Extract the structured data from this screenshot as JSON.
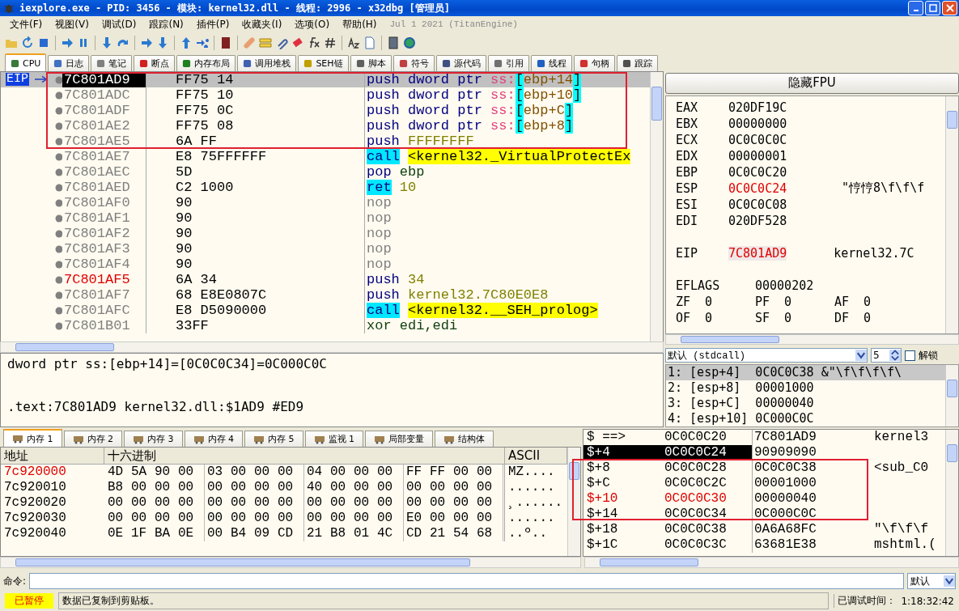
{
  "window": {
    "title": "iexplore.exe - PID: 3456 - 模块: kernel32.dll - 线程: 2996 - x32dbg [管理员]"
  },
  "menu": [
    "文件(F)",
    "视图(V)",
    "调试(D)",
    "跟踪(N)",
    "插件(P)",
    "收藏夹(I)",
    "选项(O)",
    "帮助(H)"
  ],
  "build_info": "Jul 1 2021 (TitanEngine)",
  "tabs": [
    {
      "label": "CPU",
      "selected": true
    },
    {
      "label": "日志",
      "selected": false
    },
    {
      "label": "笔记",
      "selected": false
    },
    {
      "label": "断点",
      "selected": false
    },
    {
      "label": "内存布局",
      "selected": false
    },
    {
      "label": "调用堆栈",
      "selected": false
    },
    {
      "label": "SEH链",
      "selected": false
    },
    {
      "label": "脚本",
      "selected": false
    },
    {
      "label": "符号",
      "selected": false
    },
    {
      "label": "源代码",
      "selected": false
    },
    {
      "label": "引用",
      "selected": false
    },
    {
      "label": "线程",
      "selected": false
    },
    {
      "label": "句柄",
      "selected": false
    },
    {
      "label": "跟踪",
      "selected": false
    }
  ],
  "disasm": {
    "eip_label": "EIP",
    "rows": [
      {
        "addr": "7C801AD9",
        "bytes": "FF75 14",
        "selected": true,
        "addr_highlight": false,
        "tokens": [
          {
            "text": "push",
            "kind": "op"
          },
          {
            "text": "dword",
            "kind": "size"
          },
          {
            "text": "ptr",
            "kind": "size"
          },
          {
            "text": "ss:",
            "kind": "seg"
          },
          {
            "text": "[",
            "kind": "br"
          },
          {
            "text": "ebp+14",
            "kind": "mem"
          },
          {
            "text": "]",
            "kind": "br"
          }
        ]
      },
      {
        "addr": "7C801ADC",
        "bytes": "FF75 10",
        "selected": false,
        "addr_highlight": false,
        "tokens": [
          {
            "text": "push",
            "kind": "op"
          },
          {
            "text": "dword",
            "kind": "size"
          },
          {
            "text": "ptr",
            "kind": "size"
          },
          {
            "text": "ss:",
            "kind": "seg"
          },
          {
            "text": "[",
            "kind": "br"
          },
          {
            "text": "ebp+10",
            "kind": "mem"
          },
          {
            "text": "]",
            "kind": "br"
          }
        ]
      },
      {
        "addr": "7C801ADF",
        "bytes": "FF75 0C",
        "selected": false,
        "addr_highlight": false,
        "tokens": [
          {
            "text": "push",
            "kind": "op"
          },
          {
            "text": "dword",
            "kind": "size"
          },
          {
            "text": "ptr",
            "kind": "size"
          },
          {
            "text": "ss:",
            "kind": "seg"
          },
          {
            "text": "[",
            "kind": "br"
          },
          {
            "text": "ebp+C",
            "kind": "mem"
          },
          {
            "text": "]",
            "kind": "br"
          }
        ]
      },
      {
        "addr": "7C801AE2",
        "bytes": "FF75 08",
        "selected": false,
        "addr_highlight": false,
        "tokens": [
          {
            "text": "push",
            "kind": "op"
          },
          {
            "text": "dword",
            "kind": "size"
          },
          {
            "text": "ptr",
            "kind": "size"
          },
          {
            "text": "ss:",
            "kind": "seg"
          },
          {
            "text": "[",
            "kind": "br"
          },
          {
            "text": "ebp+8",
            "kind": "mem"
          },
          {
            "text": "]",
            "kind": "br"
          }
        ]
      },
      {
        "addr": "7C801AE5",
        "bytes": "6A FF",
        "selected": false,
        "addr_highlight": false,
        "tokens": [
          {
            "text": "push",
            "kind": "op"
          },
          {
            "text": "FFFFFFFF",
            "kind": "num"
          }
        ]
      },
      {
        "addr": "7C801AE7",
        "bytes": "E8 75FFFFFF",
        "selected": false,
        "addr_highlight": false,
        "tokens": [
          {
            "text": "call",
            "kind": "callop"
          },
          {
            "text": "<kernel32._VirtualProtectEx",
            "kind": "label"
          }
        ]
      },
      {
        "addr": "7C801AEC",
        "bytes": "5D",
        "selected": false,
        "addr_highlight": false,
        "tokens": [
          {
            "text": "pop",
            "kind": "op"
          },
          {
            "text": "ebp",
            "kind": "reg"
          }
        ]
      },
      {
        "addr": "7C801AED",
        "bytes": "C2 1000",
        "selected": false,
        "addr_highlight": false,
        "tokens": [
          {
            "text": "ret",
            "kind": "callop"
          },
          {
            "text": "10",
            "kind": "num"
          }
        ]
      },
      {
        "addr": "7C801AF0",
        "bytes": "90",
        "selected": false,
        "addr_highlight": false,
        "tokens": [
          {
            "text": "nop",
            "kind": "nop"
          }
        ]
      },
      {
        "addr": "7C801AF1",
        "bytes": "90",
        "selected": false,
        "addr_highlight": false,
        "tokens": [
          {
            "text": "nop",
            "kind": "nop"
          }
        ]
      },
      {
        "addr": "7C801AF2",
        "bytes": "90",
        "selected": false,
        "addr_highlight": false,
        "tokens": [
          {
            "text": "nop",
            "kind": "nop"
          }
        ]
      },
      {
        "addr": "7C801AF3",
        "bytes": "90",
        "selected": false,
        "addr_highlight": false,
        "tokens": [
          {
            "text": "nop",
            "kind": "nop"
          }
        ]
      },
      {
        "addr": "7C801AF4",
        "bytes": "90",
        "selected": false,
        "addr_highlight": false,
        "tokens": [
          {
            "text": "nop",
            "kind": "nop"
          }
        ]
      },
      {
        "addr": "7C801AF5",
        "bytes": "6A 34",
        "selected": false,
        "addr_highlight": true,
        "tokens": [
          {
            "text": "push",
            "kind": "op"
          },
          {
            "text": "34",
            "kind": "num"
          }
        ]
      },
      {
        "addr": "7C801AF7",
        "bytes": "68 E8E0807C",
        "selected": false,
        "addr_highlight": false,
        "tokens": [
          {
            "text": "push",
            "kind": "op"
          },
          {
            "text": "kernel32.7C80E0E8",
            "kind": "num"
          }
        ]
      },
      {
        "addr": "7C801AFC",
        "bytes": "E8 D5090000",
        "selected": false,
        "addr_highlight": false,
        "tokens": [
          {
            "text": "call",
            "kind": "callop"
          },
          {
            "text": "<kernel32.__SEH_prolog>",
            "kind": "label"
          }
        ]
      },
      {
        "addr": "7C801B01",
        "bytes": "33FF",
        "selected": false,
        "addr_highlight": false,
        "tokens": [
          {
            "text": "xor",
            "kind": "reg"
          },
          {
            "text": "edi,edi",
            "kind": "reg"
          }
        ]
      }
    ]
  },
  "info": [
    "dword ptr ss:[ebp+14]=[0C0C0C34]=0C000C0C",
    ".text:7C801AD9 kernel32.dll:$1AD9 #ED9"
  ],
  "fpu_button": "隐藏FPU",
  "registers": [
    {
      "name": "EAX",
      "value": "020DF19C",
      "changed": false
    },
    {
      "name": "EBX",
      "value": "00000000",
      "changed": false
    },
    {
      "name": "ECX",
      "value": "0C0C0C0C",
      "changed": false
    },
    {
      "name": "EDX",
      "value": "00000001",
      "changed": false
    },
    {
      "name": "EBP",
      "value": "0C0C0C20",
      "changed": false
    },
    {
      "name": "ESP",
      "value": "0C0C0C24",
      "changed": true,
      "comment": "\"悙悙8\\f\\f\\f"
    },
    {
      "name": "ESI",
      "value": "0C0C0C08",
      "changed": false
    },
    {
      "name": "EDI",
      "value": "020DF528",
      "changed": false
    }
  ],
  "eip": {
    "name": "EIP",
    "value": "7C801AD9",
    "changed": true,
    "comment": "kernel32.7C"
  },
  "eflags": {
    "name": "EFLAGS",
    "value": "00000202"
  },
  "flags": [
    [
      {
        "name": "ZF",
        "value": "0"
      },
      {
        "name": "PF",
        "value": "0"
      },
      {
        "name": "AF",
        "value": "0"
      }
    ],
    [
      {
        "name": "OF",
        "value": "0"
      },
      {
        "name": "SF",
        "value": "0"
      },
      {
        "name": "DF",
        "value": "0"
      }
    ]
  ],
  "call_convention": {
    "value": "默认 (stdcall)",
    "arg_count": "5",
    "lock_label": "解锁",
    "lock_checked": false
  },
  "args": [
    {
      "text": "1: [esp+4]  0C0C0C38 &\"\\f\\f\\f\\f\\",
      "selected": true
    },
    {
      "text": "2: [esp+8]  00001000",
      "selected": false
    },
    {
      "text": "3: [esp+C]  00000040",
      "selected": false
    },
    {
      "text": "4: [esp+10] 0C000C0C",
      "selected": false
    }
  ],
  "dump_tabs": [
    {
      "label": "内存 1",
      "selected": true
    },
    {
      "label": "内存 2",
      "selected": false
    },
    {
      "label": "内存 3",
      "selected": false
    },
    {
      "label": "内存 4",
      "selected": false
    },
    {
      "label": "内存 5",
      "selected": false
    },
    {
      "label": "监视 1",
      "selected": false
    },
    {
      "label": "局部变量",
      "selected": false
    },
    {
      "label": "结构体",
      "selected": false
    }
  ],
  "dump": {
    "columns": [
      "地址",
      "十六进制",
      "ASCII"
    ],
    "rows": [
      {
        "addr": "7c920000",
        "highlight": true,
        "hex": [
          "4D",
          "5A",
          "90",
          "00",
          "03",
          "00",
          "00",
          "00",
          "04",
          "00",
          "00",
          "00",
          "FF",
          "FF",
          "00",
          "00"
        ],
        "ascii": "MZ...."
      },
      {
        "addr": "7c920010",
        "highlight": false,
        "hex": [
          "B8",
          "00",
          "00",
          "00",
          "00",
          "00",
          "00",
          "00",
          "40",
          "00",
          "00",
          "00",
          "00",
          "00",
          "00",
          "00"
        ],
        "ascii": "......"
      },
      {
        "addr": "7c920020",
        "highlight": false,
        "hex": [
          "00",
          "00",
          "00",
          "00",
          "00",
          "00",
          "00",
          "00",
          "00",
          "00",
          "00",
          "00",
          "00",
          "00",
          "00",
          "00"
        ],
        "ascii": "¸......"
      },
      {
        "addr": "7c920030",
        "highlight": false,
        "hex": [
          "00",
          "00",
          "00",
          "00",
          "00",
          "00",
          "00",
          "00",
          "00",
          "00",
          "00",
          "00",
          "E0",
          "00",
          "00",
          "00"
        ],
        "ascii": "......"
      },
      {
        "addr": "7c920040",
        "highlight": false,
        "hex": [
          "0E",
          "1F",
          "BA",
          "0E",
          "00",
          "B4",
          "09",
          "CD",
          "21",
          "B8",
          "01",
          "4C",
          "CD",
          "21",
          "54",
          "68"
        ],
        "ascii": "..º.."
      }
    ]
  },
  "stack": [
    {
      "offset": "$ ==>",
      "addr": "0C0C0C20",
      "value": "7C801AD9",
      "comment": "kernel3",
      "selected": false,
      "highlight": false
    },
    {
      "offset": "$+4",
      "addr": "0C0C0C24",
      "value": "90909090",
      "selected": true,
      "highlight": false
    },
    {
      "offset": "$+8",
      "addr": "0C0C0C28",
      "value": "0C0C0C38",
      "comment": "<sub_C0",
      "selected": false,
      "highlight": false
    },
    {
      "offset": "$+C",
      "addr": "0C0C0C2C",
      "value": "00001000",
      "selected": false,
      "highlight": false
    },
    {
      "offset": "$+10",
      "addr": "0C0C0C30",
      "value": "00000040",
      "selected": false,
      "highlight": true
    },
    {
      "offset": "$+14",
      "addr": "0C0C0C34",
      "value": "0C000C0C",
      "selected": false,
      "highlight": false
    },
    {
      "offset": "$+18",
      "addr": "0C0C0C38",
      "value": "0A6A68FC",
      "comment": "\"\\f\\f\\f",
      "selected": false,
      "highlight": false
    },
    {
      "offset": "$+1C",
      "addr": "0C0C0C3C",
      "value": "63681E38",
      "comment": "mshtml.(",
      "selected": false,
      "highlight": false
    }
  ],
  "command": {
    "label": "命令:",
    "mode": "默认"
  },
  "status_bar": {
    "state": "已暂停",
    "message": "数据已复制到剪贴板。",
    "time_label": "已调试时间：",
    "time": "1:18:32:42"
  }
}
